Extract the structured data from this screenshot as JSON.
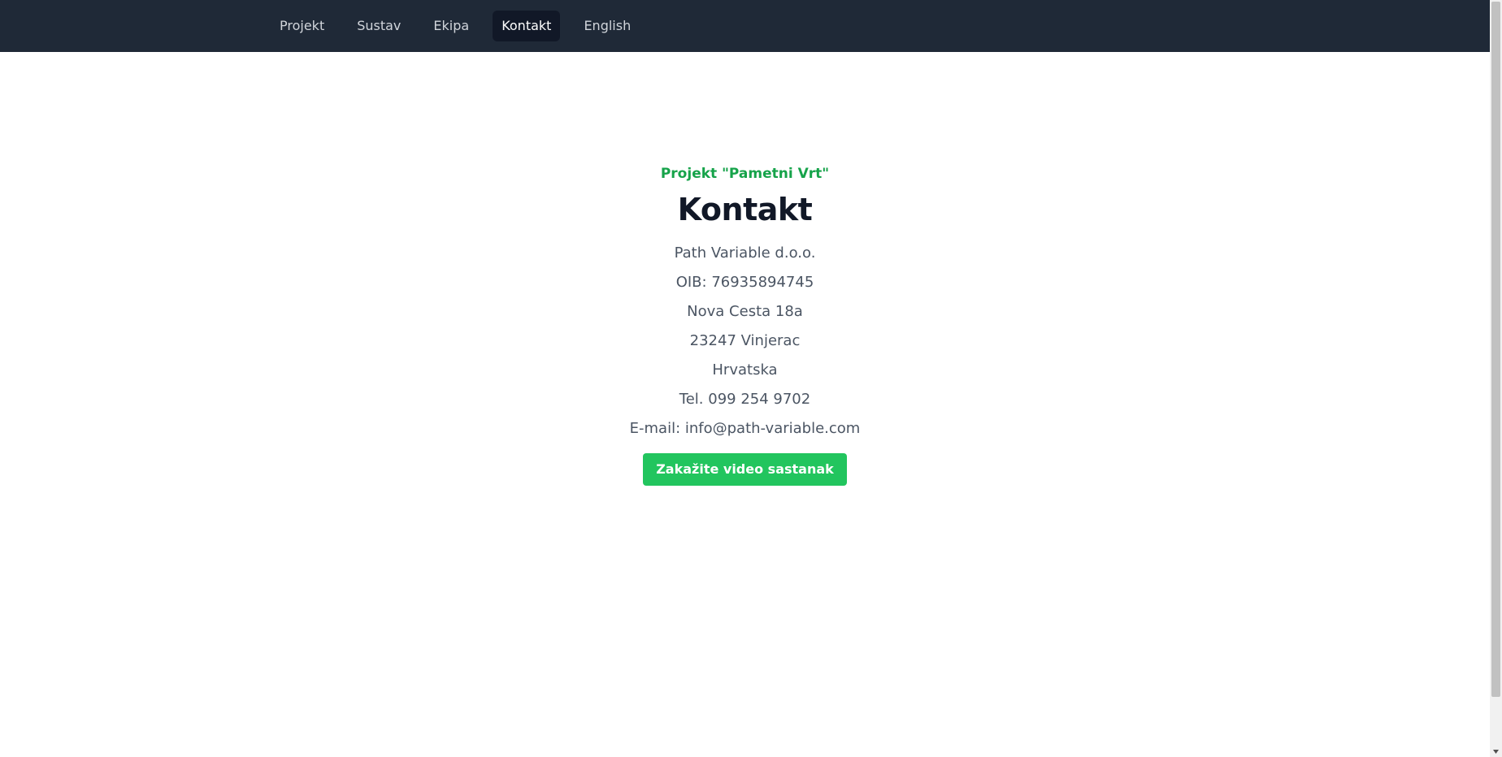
{
  "nav": {
    "items": [
      {
        "label": "Projekt",
        "active": false
      },
      {
        "label": "Sustav",
        "active": false
      },
      {
        "label": "Ekipa",
        "active": false
      },
      {
        "label": "Kontakt",
        "active": true
      },
      {
        "label": "English",
        "active": false
      }
    ]
  },
  "main": {
    "eyebrow": "Projekt \"Pametni Vrt\"",
    "title": "Kontakt",
    "company": "Path Variable d.o.o.",
    "oib": "OIB: 76935894745",
    "street": "Nova Cesta 18a",
    "city": "23247 Vinjerac",
    "country": "Hrvatska",
    "phone": "Tel. 099 254 9702",
    "email": "E-mail: info@path-variable.com",
    "cta_label": "Zakažite video sastanak"
  },
  "scrollbar": {
    "down_arrow_icon": "triangle-down-icon"
  },
  "colors": {
    "navbar_bg": "#1f2937",
    "nav_active_bg": "#111827",
    "accent_green": "#16a34a",
    "button_green": "#22c55e",
    "title_text": "#111827",
    "body_text": "#4b5563"
  }
}
